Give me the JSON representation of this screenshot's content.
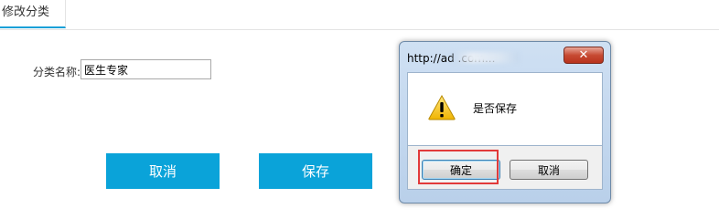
{
  "tabs": {
    "active_label": "修改分类"
  },
  "form": {
    "field_label": "分类名称:",
    "field_value": "医生专家",
    "cancel_label": "取消",
    "save_label": "保存"
  },
  "dialog": {
    "title": "http://ad                    .com...",
    "close_glyph": "✕",
    "icon": "warning-icon",
    "message": "是否保存",
    "ok_label": "确定",
    "cancel_label": "取消"
  },
  "colors": {
    "accent": "#0aa3d9",
    "tab_underline": "#1aa0d8",
    "highlight": "#e23a3a",
    "close_button": "#c74a33"
  }
}
